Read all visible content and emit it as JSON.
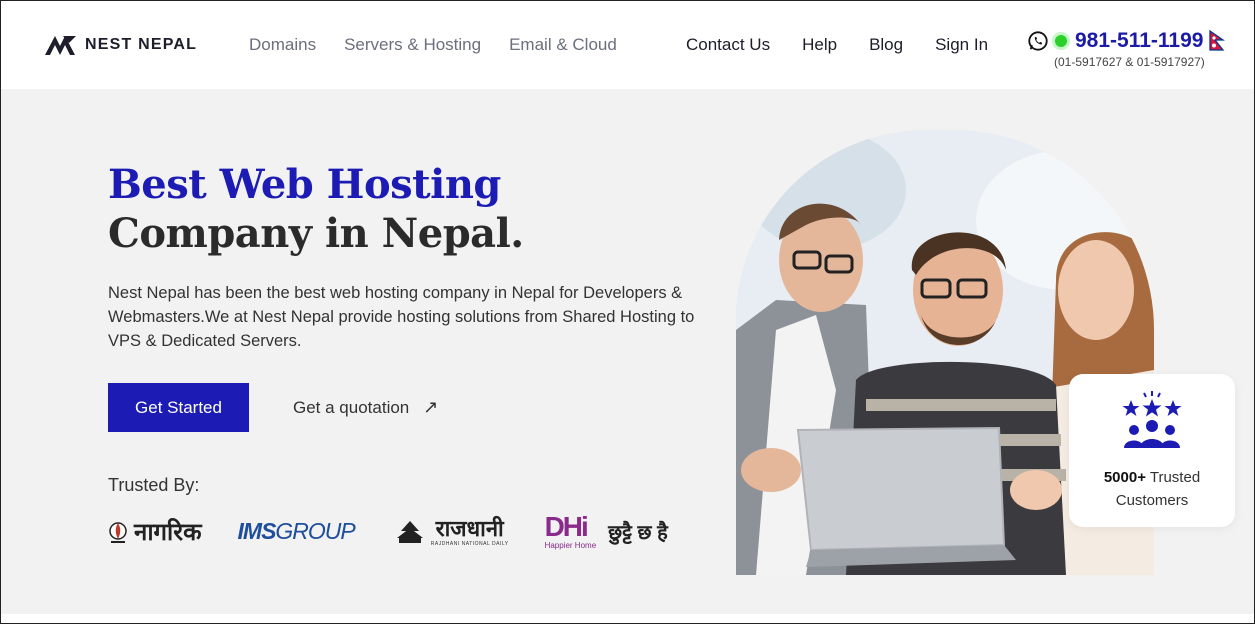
{
  "header": {
    "logo_text": "NEST NEPAL",
    "nav_left": [
      "Domains",
      "Servers & Hosting",
      "Email & Cloud"
    ],
    "nav_right": [
      "Contact Us",
      "Help",
      "Blog",
      "Sign In"
    ],
    "phone": "981-511-1199",
    "phone_alt": "(01-5917627 & 01-5917927)"
  },
  "hero": {
    "title_line1": "Best Web Hosting",
    "title_line2": "Company in Nepal.",
    "description": "Nest Nepal has been the best web hosting company in Nepal for Developers & Webmasters.We at Nest Nepal provide hosting solutions from Shared Hosting to VPS & Dedicated Servers.",
    "cta_primary": "Get Started",
    "cta_secondary": "Get a quotation",
    "cta_secondary_arrow": "↗",
    "trusted_label": "Trusted By:"
  },
  "trusted_logos": {
    "nagarik": "नागरिक",
    "ims_bold": "IMS",
    "ims_rest": "GROUP",
    "rajdhani": "राजधानी",
    "rajdhani_sub": "RAJDHANI NATIONAL DAILY",
    "dhi": "DHi",
    "dhi_sub": "Happier Home",
    "dhi_tag": "छुट्टै छ है"
  },
  "card": {
    "count": "5000+",
    "label_rest": " Trusted",
    "label_line2": "Customers"
  },
  "colors": {
    "brand_blue": "#1c1cb4",
    "hero_bg": "#f2f2f2",
    "whatsapp_green": "#2bd02b"
  },
  "icons": [
    "nest-nepal-logo-icon",
    "whatsapp-icon",
    "online-dot-icon",
    "nepal-flag-icon",
    "arrow-up-right-icon",
    "customers-stars-icon"
  ]
}
